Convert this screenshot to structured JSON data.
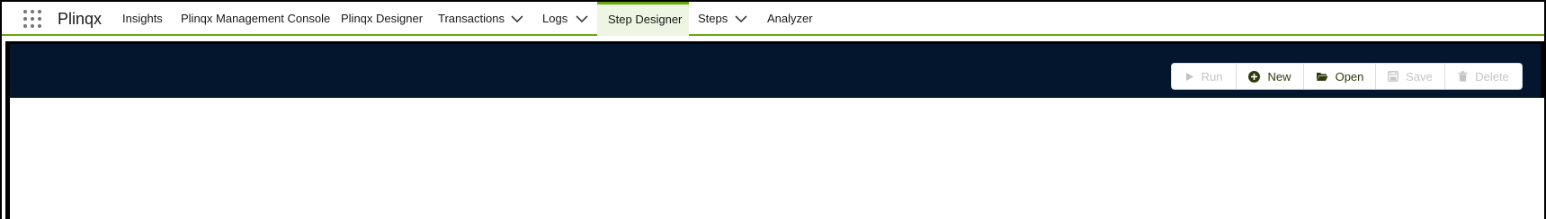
{
  "app": {
    "name": "Plinqx",
    "menu_icon": "app-launcher-icon"
  },
  "nav": {
    "items": [
      {
        "label": "Insights",
        "has_dropdown": false
      },
      {
        "label": "Plinqx Management Console",
        "has_dropdown": false
      },
      {
        "label": "Plinqx Designer",
        "has_dropdown": false
      },
      {
        "label": "Transactions",
        "has_dropdown": true
      },
      {
        "label": "Logs",
        "has_dropdown": true
      },
      {
        "label": "Step Designer",
        "has_dropdown": false,
        "active": true
      },
      {
        "label": "Steps",
        "has_dropdown": true
      },
      {
        "label": "Analyzer",
        "has_dropdown": false
      }
    ],
    "accent_color": "#6aa70a"
  },
  "toolbar": {
    "run": {
      "label": "Run",
      "icon": "play-icon",
      "enabled": false
    },
    "new": {
      "label": "New",
      "icon": "plus-circle-icon",
      "enabled": true
    },
    "open": {
      "label": "Open",
      "icon": "folder-open-icon",
      "enabled": true
    },
    "save": {
      "label": "Save",
      "icon": "save-icon",
      "enabled": false
    },
    "delete": {
      "label": "Delete",
      "icon": "trash-icon",
      "enabled": false
    }
  },
  "colors": {
    "banner": "#03162e",
    "enabled_text": "#2f3b0f",
    "disabled_text": "#c4c4c4"
  }
}
